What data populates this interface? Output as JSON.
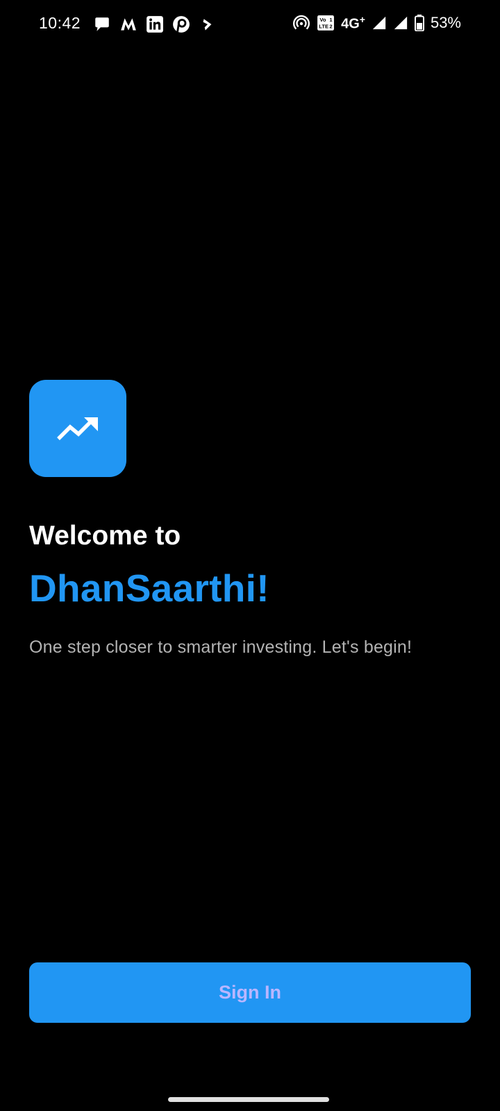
{
  "status_bar": {
    "time": "10:42",
    "network": "4G",
    "network_plus": "+",
    "battery": "53%",
    "icons_left": [
      "chat-bubble-icon",
      "myntra-m-icon",
      "linkedin-icon",
      "pinterest-p-icon",
      "arrow-app-icon"
    ],
    "icons_right": [
      "hotspot-icon",
      "volte-icon",
      "signal-icon",
      "signal-icon",
      "battery-icon"
    ]
  },
  "app": {
    "logo_icon": "trending-up-icon",
    "welcome": "Welcome to",
    "name": "DhanSaarthi!",
    "tagline": "One step closer to smarter investing. Let's begin!"
  },
  "actions": {
    "signin_label": "Sign In"
  },
  "colors": {
    "background": "#000000",
    "accent": "#2196F3",
    "button_text": "#b9b6ff",
    "tagline": "#b3b3b3"
  }
}
